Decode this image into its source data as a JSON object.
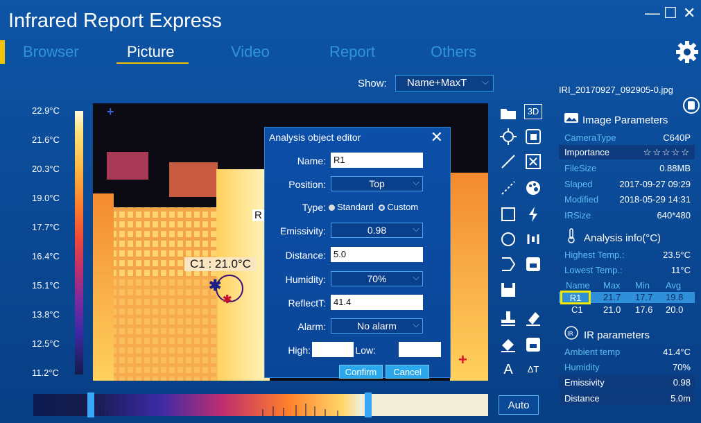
{
  "app_title": "Infrared Report Express",
  "window_controls": {
    "minimize": "—",
    "maximize": "☐",
    "close": "✕"
  },
  "nav": {
    "tabs": [
      "Browser",
      "Picture",
      "Video",
      "Report",
      "Others"
    ],
    "active": "Picture"
  },
  "show": {
    "label": "Show:",
    "value": "Name+MaxT"
  },
  "filename": "IRI_20170927_092905-0.jpg",
  "scale_labels": [
    "22.9°C",
    "21.6°C",
    "20.3°C",
    "19.0°C",
    "17.7°C",
    "16.4°C",
    "15.1°C",
    "13.8°C",
    "12.5°C",
    "11.2°C"
  ],
  "image": {
    "cursor_label": "C1 : 21.0°C",
    "region_label": "R"
  },
  "dialog": {
    "title": "Analysis object editor",
    "close": "✕",
    "name_label": "Name:",
    "name_value": "R1",
    "position_label": "Position:",
    "position_value": "Top",
    "type_label": "Type:",
    "type_standard": "Standard",
    "type_custom": "Custom",
    "emissivity_label": "Emissivity:",
    "emissivity_value": "0.98",
    "distance_label": "Distance:",
    "distance_value": "5.0",
    "humidity_label": "Humidity:",
    "humidity_value": "70%",
    "reflect_label": "ReflectT:",
    "reflect_value": "41.4",
    "alarm_label": "Alarm:",
    "alarm_value": "No alarm",
    "high_label": "High:",
    "low_label": "Low:",
    "confirm": "Confirm",
    "cancel": "Cancel"
  },
  "tools": {
    "three_d": "3D",
    "text_a": "A",
    "text_at": "ΔT"
  },
  "image_params": {
    "title": "Image Parameters",
    "rows": [
      {
        "key": "CameraType",
        "value": "C640P"
      },
      {
        "key": "Importance",
        "value": "☆☆☆☆☆"
      },
      {
        "key": "FileSize",
        "value": "0.88MB"
      },
      {
        "key": "Slaped",
        "value": "2017-09-27 09:29"
      },
      {
        "key": "Modified",
        "value": "2018-05-29 14:31"
      },
      {
        "key": "IRSize",
        "value": "640*480"
      }
    ]
  },
  "analysis_info": {
    "title": "Analysis info(°C)",
    "highest_label": "Highest Temp.:",
    "highest_value": "23.5°C",
    "lowest_label": "Lowest Temp.:",
    "lowest_value": "11°C",
    "columns": [
      "Name",
      "Max",
      "Min",
      "Avg"
    ],
    "rows": [
      {
        "name": "R1",
        "max": "21.7",
        "min": "17.7",
        "avg": "19.8"
      },
      {
        "name": "C1",
        "max": "21.0",
        "min": "17.6",
        "avg": "20.0"
      }
    ]
  },
  "ir_params": {
    "title": "IR parameters",
    "rows": [
      {
        "key": "Ambient temp",
        "value": "41.4°C"
      },
      {
        "key": "Humidity",
        "value": "70%"
      },
      {
        "key": "Emissivity",
        "value": "0.98"
      },
      {
        "key": "Distance",
        "value": "5.0m"
      }
    ]
  },
  "histogram": {
    "auto_label": "Auto"
  },
  "colors": {
    "accent": "#f3c300",
    "background": "#0a4792",
    "link": "#2f95d8",
    "highlight_border": "#f3e600"
  }
}
